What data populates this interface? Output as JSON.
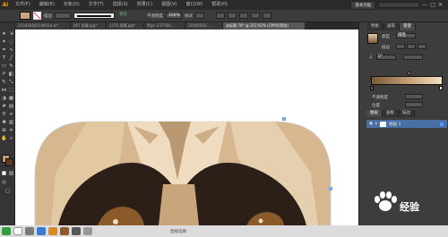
{
  "app": {
    "logo": "Ai"
  },
  "menubar": {
    "items": [
      "文件(F)",
      "编辑(E)",
      "对象(O)",
      "文字(T)",
      "选择(S)",
      "效果(C)",
      "视图(V)",
      "窗口(W)",
      "帮助(H)"
    ],
    "workspace": "基本功能"
  },
  "options": {
    "stroke_label": "描边",
    "opacity_label": "不透明度",
    "opacity_value": "100%",
    "style_label": "样式",
    "profile_label": "等比"
  },
  "tabs": [
    {
      "label": "243418165140014.ai*"
    },
    {
      "label": "007 屏幕.jpg*"
    },
    {
      "label": "1370 屏幕.jpg*"
    },
    {
      "label": "Mjpn 237784..."
    },
    {
      "label": "20160503..."
    },
    {
      "label": "未标题-76* @ 252.92% (CMYK/预览)"
    }
  ],
  "panel": {
    "tabs": [
      "色板",
      "画笔",
      "渐变"
    ],
    "gradient_type_label": "类型",
    "gradient_type_value": "线性",
    "stroke_label": "描边",
    "angle_value": "0°",
    "opacity_label": "不透明度",
    "location_label": "位置",
    "layers_tabs": [
      "图层",
      "画板",
      "描边"
    ],
    "layer_name": "图层 1"
  },
  "taskbar": {
    "status": "直接选择"
  },
  "watermark": {
    "text": "经验"
  },
  "colors": {
    "fill": "#c39b72",
    "stroke": "#5a3b20",
    "tan_light": "#f1dfc3",
    "tan_mid": "#d6b790",
    "dark_brown": "#2b1f18"
  }
}
